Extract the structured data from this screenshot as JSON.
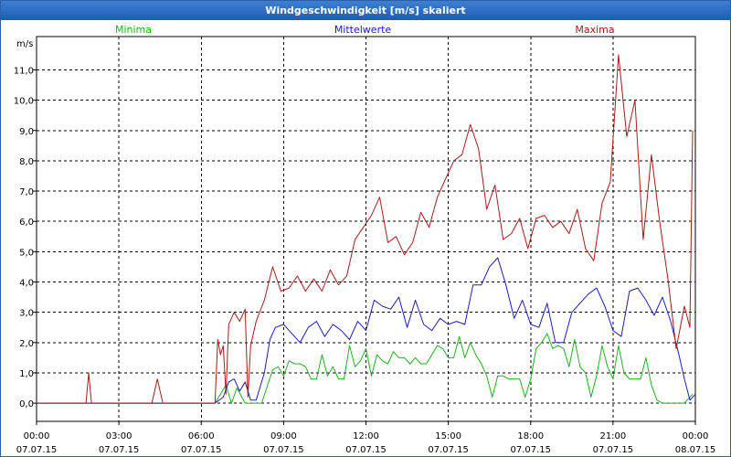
{
  "window": {
    "title": "Windgeschwindigkeit [m/s] skaliert"
  },
  "chart_data": {
    "type": "line",
    "title": "Windgeschwindigkeit [m/s] skaliert",
    "ylabel": "m/s",
    "xlabel": "",
    "ylim": [
      -0.6,
      12.1
    ],
    "y_ticks": [
      "0,0",
      "1,0",
      "2,0",
      "3,0",
      "4,0",
      "5,0",
      "6,0",
      "7,0",
      "8,0",
      "9,0",
      "10,0",
      "11,0"
    ],
    "x_range_hours": [
      0,
      24
    ],
    "x_ticks": [
      {
        "time": "00:00",
        "date": "07.07.15"
      },
      {
        "time": "03:00",
        "date": "07.07.15"
      },
      {
        "time": "06:00",
        "date": "07.07.15"
      },
      {
        "time": "09:00",
        "date": "07.07.15"
      },
      {
        "time": "12:00",
        "date": "07.07.15"
      },
      {
        "time": "15:00",
        "date": "07.07.15"
      },
      {
        "time": "18:00",
        "date": "07.07.15"
      },
      {
        "time": "21:00",
        "date": "07.07.15"
      },
      {
        "time": "00:00",
        "date": "08.07.15"
      }
    ],
    "grid": true,
    "legend_position": "top",
    "series": [
      {
        "name": "Minima",
        "color": "#20b020",
        "x": [
          0,
          6.5,
          6.9,
          7.1,
          7.3,
          7.6,
          7.8,
          8.0,
          8.2,
          8.6,
          8.8,
          9.0,
          9.2,
          9.4,
          9.6,
          9.8,
          10.0,
          10.2,
          10.4,
          10.6,
          10.8,
          11.0,
          11.2,
          11.4,
          11.6,
          11.8,
          12.0,
          12.2,
          12.4,
          12.6,
          12.8,
          13.0,
          13.2,
          13.4,
          13.6,
          13.8,
          14.0,
          14.2,
          14.4,
          14.6,
          14.8,
          15.0,
          15.2,
          15.4,
          15.6,
          15.8,
          16.0,
          16.2,
          16.4,
          16.6,
          16.8,
          17.0,
          17.2,
          17.4,
          17.6,
          17.8,
          18.0,
          18.2,
          18.4,
          18.6,
          18.8,
          19.0,
          19.2,
          19.4,
          19.6,
          19.8,
          20.0,
          20.2,
          20.4,
          20.6,
          20.8,
          21.0,
          21.2,
          21.4,
          21.6,
          21.8,
          22.0,
          22.2,
          22.4,
          22.6,
          22.8,
          23.0,
          23.2,
          23.4,
          23.6,
          23.9
        ],
        "values": [
          0.0,
          0.0,
          0.6,
          0.0,
          0.5,
          0.0,
          0.0,
          0.0,
          0.0,
          1.1,
          1.2,
          0.9,
          1.4,
          1.3,
          1.3,
          1.2,
          0.8,
          0.8,
          1.6,
          0.9,
          1.2,
          0.8,
          0.8,
          1.9,
          1.2,
          1.4,
          1.8,
          0.9,
          1.6,
          1.4,
          1.3,
          1.7,
          1.5,
          1.5,
          1.3,
          1.5,
          1.3,
          1.3,
          1.6,
          1.9,
          1.8,
          1.5,
          1.5,
          2.2,
          1.5,
          2.0,
          1.6,
          1.3,
          0.9,
          0.2,
          0.9,
          0.9,
          0.8,
          0.8,
          0.8,
          0.2,
          0.8,
          1.8,
          2.0,
          2.3,
          1.8,
          1.9,
          1.8,
          1.2,
          2.1,
          1.2,
          1.0,
          0.2,
          0.9,
          1.9,
          1.2,
          0.8,
          1.9,
          1.0,
          0.8,
          0.8,
          0.8,
          1.5,
          0.6,
          0.1,
          0.0,
          0.0,
          0.0,
          0.0,
          0.0,
          0.3
        ]
      },
      {
        "name": "Mittelwerte",
        "color": "#1a1acc",
        "x": [
          0,
          6.5,
          6.8,
          7.0,
          7.2,
          7.4,
          7.6,
          7.8,
          8.0,
          8.3,
          8.5,
          8.7,
          9.0,
          9.3,
          9.6,
          9.9,
          10.2,
          10.5,
          10.8,
          11.1,
          11.4,
          11.7,
          12.0,
          12.3,
          12.6,
          12.9,
          13.2,
          13.5,
          13.8,
          14.1,
          14.4,
          14.7,
          15.0,
          15.3,
          15.6,
          15.9,
          16.2,
          16.5,
          16.8,
          17.1,
          17.4,
          17.7,
          18.0,
          18.3,
          18.6,
          18.9,
          19.2,
          19.5,
          19.8,
          20.1,
          20.4,
          20.7,
          21.0,
          21.3,
          21.6,
          21.9,
          22.2,
          22.5,
          22.8,
          23.1,
          23.4,
          23.6,
          23.8,
          24.0
        ],
        "values": [
          0.0,
          0.0,
          0.2,
          0.7,
          0.8,
          0.4,
          0.7,
          0.1,
          0.1,
          1.0,
          2.1,
          2.5,
          2.6,
          2.3,
          2.0,
          2.5,
          2.7,
          2.2,
          2.6,
          2.4,
          2.1,
          2.7,
          2.4,
          3.4,
          3.2,
          3.1,
          3.5,
          2.5,
          3.4,
          2.6,
          2.4,
          2.8,
          2.6,
          2.7,
          2.6,
          3.9,
          3.9,
          4.5,
          4.8,
          3.9,
          2.8,
          3.4,
          2.6,
          2.5,
          3.3,
          2.0,
          2.0,
          3.0,
          3.3,
          3.6,
          3.8,
          3.2,
          2.4,
          2.2,
          3.7,
          3.8,
          3.4,
          2.9,
          3.5,
          2.7,
          1.6,
          0.8,
          0.1,
          0.3
        ]
      },
      {
        "name": "Maxima",
        "color": "#b01818",
        "x": [
          0,
          1.8,
          1.9,
          2.0,
          4.2,
          4.4,
          4.6,
          6.5,
          6.6,
          6.7,
          6.8,
          6.9,
          7.0,
          7.2,
          7.4,
          7.6,
          7.7,
          7.8,
          8.0,
          8.3,
          8.6,
          8.9,
          9.2,
          9.5,
          9.8,
          10.1,
          10.4,
          10.7,
          11.0,
          11.3,
          11.6,
          11.9,
          12.2,
          12.5,
          12.8,
          13.1,
          13.4,
          13.7,
          14.0,
          14.3,
          14.6,
          14.9,
          15.2,
          15.5,
          15.8,
          16.1,
          16.4,
          16.7,
          17.0,
          17.3,
          17.6,
          17.9,
          18.2,
          18.5,
          18.8,
          19.1,
          19.4,
          19.7,
          20.0,
          20.3,
          20.6,
          20.9,
          21.2,
          21.5,
          21.8,
          22.1,
          22.4,
          22.7,
          23.0,
          23.3,
          23.6,
          23.8,
          23.9
        ],
        "values": [
          0.0,
          0.0,
          1.0,
          0.0,
          0.0,
          0.8,
          0.0,
          0.0,
          2.1,
          1.6,
          1.9,
          0.3,
          2.6,
          3.0,
          2.7,
          3.1,
          0.2,
          1.9,
          2.7,
          3.4,
          4.5,
          3.7,
          3.8,
          4.2,
          3.7,
          4.1,
          3.7,
          4.4,
          3.9,
          4.2,
          5.4,
          5.8,
          6.2,
          6.8,
          5.3,
          5.5,
          4.9,
          5.3,
          6.3,
          5.8,
          6.8,
          7.4,
          8.0,
          8.2,
          9.2,
          8.4,
          6.4,
          7.2,
          5.4,
          5.6,
          6.1,
          5.1,
          6.1,
          6.2,
          5.8,
          6.0,
          5.6,
          6.4,
          5.1,
          4.7,
          6.6,
          7.3,
          11.5,
          8.8,
          10.0,
          5.4,
          8.2,
          6.0,
          4.1,
          1.8,
          3.2,
          2.5,
          9.0
        ]
      }
    ]
  }
}
